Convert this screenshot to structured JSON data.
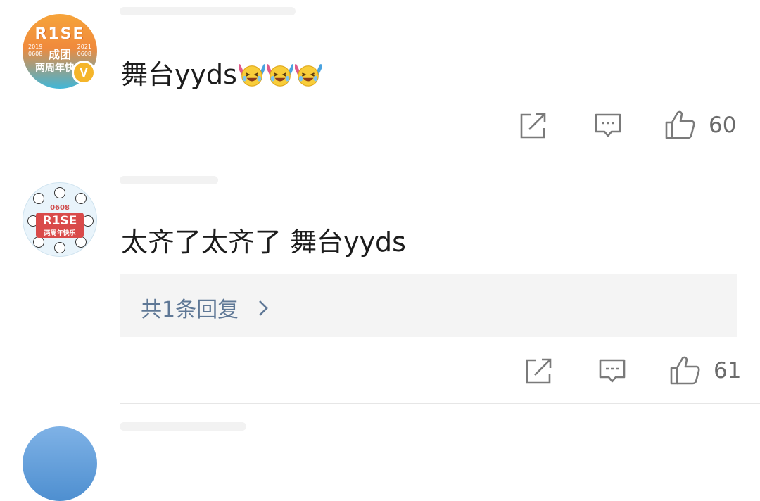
{
  "comments": [
    {
      "avatar_lines": [
        "R1SE",
        "成团",
        "两周年快乐"
      ],
      "avatar_years": [
        "2019",
        "0608",
        "2021",
        "0608"
      ],
      "badge": "V",
      "text": "舞台yyds",
      "emoji_count": 3,
      "emoji_icon": "laughing-face-with-sticks-icon",
      "likes": "60"
    },
    {
      "avatar_lines": [
        "0608",
        "R1SE",
        "两周年快乐"
      ],
      "text": "太齐了太齐了 舞台yyds",
      "reply_link": "共1条回复",
      "likes": "61"
    }
  ],
  "icons": {
    "share": "share-icon",
    "comment": "comment-icon",
    "like": "thumbs-up-icon",
    "chevron": "chevron-right-icon"
  },
  "colors": {
    "icon": "#7a7a7a",
    "link": "#5f7896",
    "vip_badge": "#f5b52a"
  }
}
